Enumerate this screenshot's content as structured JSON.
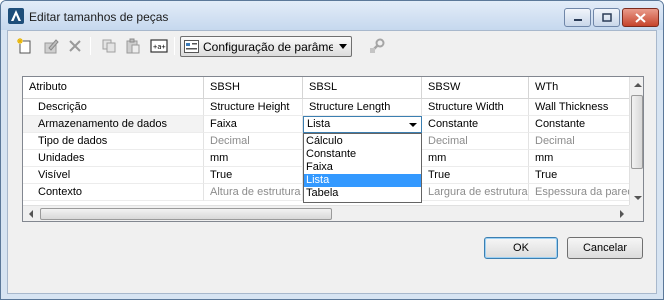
{
  "window": {
    "title": "Editar tamanhos de peças",
    "icon": "autocad-a-icon",
    "controls": [
      "minimize-icon",
      "maximize-icon",
      "close-icon"
    ]
  },
  "toolbar": {
    "buttons": [
      "new-size-icon",
      "edit-icon",
      "delete-icon",
      "copy-icon",
      "paste-icon",
      "insert-parameter-icon"
    ],
    "config_combo": "Configuração de parâmetros",
    "disabled_tool_icon": "settings-tool-icon"
  },
  "grid": {
    "headers": [
      "Atributo",
      "SBSH",
      "SBSL",
      "SBSW",
      "WTh"
    ],
    "rows": [
      {
        "attr": "Descrição",
        "values": [
          "Structure Height",
          "Structure Length",
          "Structure Width",
          "Wall Thickness"
        ],
        "grey": false
      },
      {
        "attr": "Armazenamento de dados",
        "values": [
          "Faixa",
          "Lista",
          "Constante",
          "Constante"
        ],
        "grey": false
      },
      {
        "attr": "Tipo de dados",
        "values": [
          "Decimal",
          "",
          "Decimal",
          "Decimal"
        ],
        "grey": true
      },
      {
        "attr": "Unidades",
        "values": [
          "mm",
          "",
          "mm",
          "mm"
        ],
        "grey": false
      },
      {
        "attr": "Visível",
        "values": [
          "True",
          "",
          "True",
          "True"
        ],
        "grey": false
      },
      {
        "attr": "Contexto",
        "values": [
          "Altura de estrutura",
          "",
          "Largura de estrutura",
          "Espessura da parede"
        ],
        "grey": true
      }
    ],
    "editor_value": "Lista",
    "dropdown_options": [
      "Cálculo",
      "Constante",
      "Faixa",
      "Lista",
      "Tabela"
    ],
    "dropdown_selected": "Lista"
  },
  "buttons": {
    "ok": "OK",
    "cancel": "Cancelar"
  },
  "colors": {
    "selection": "#3399ff",
    "title_bg": "#d7e4f2",
    "close_red": "#c6442c"
  }
}
